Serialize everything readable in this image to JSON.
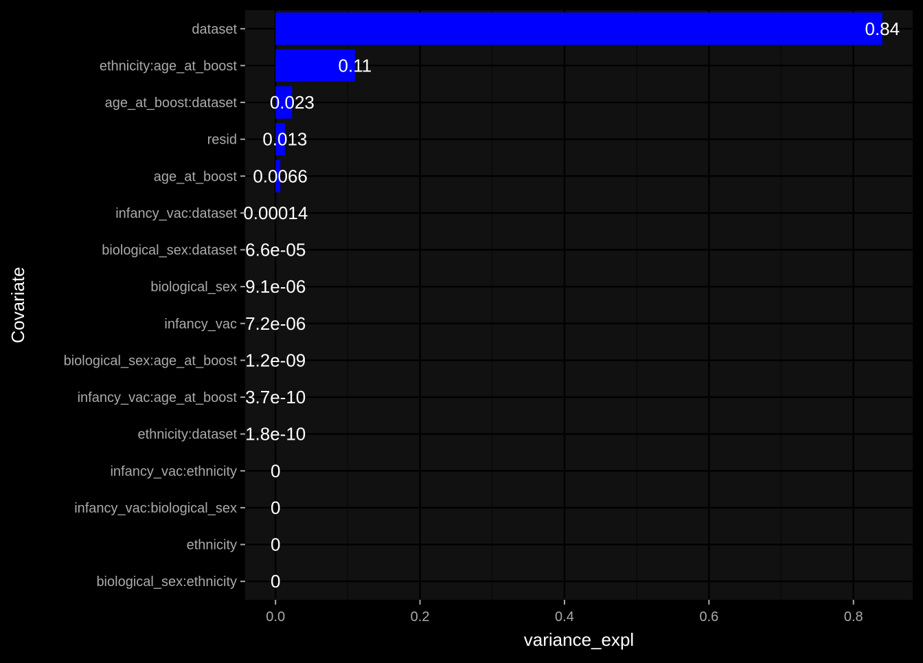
{
  "chart_data": {
    "type": "bar",
    "orientation": "horizontal",
    "title": "",
    "xlabel": "variance_expl",
    "ylabel": "Covariate",
    "categories": [
      "dataset",
      "ethnicity:age_at_boost",
      "age_at_boost:dataset",
      "resid",
      "age_at_boost",
      "infancy_vac:dataset",
      "biological_sex:dataset",
      "biological_sex",
      "infancy_vac",
      "biological_sex:age_at_boost",
      "infancy_vac:age_at_boost",
      "ethnicity:dataset",
      "infancy_vac:ethnicity",
      "infancy_vac:biological_sex",
      "ethnicity",
      "biological_sex:ethnicity"
    ],
    "values": [
      0.84,
      0.11,
      0.023,
      0.013,
      0.0066,
      0.00014,
      6.6e-05,
      9.1e-06,
      7.2e-06,
      1.2e-09,
      3.7e-10,
      1.8e-10,
      0,
      0,
      0,
      0
    ],
    "data_labels": [
      "0.84",
      "0.11",
      "0.023",
      "0.013",
      "0.0066",
      "0.00014",
      "6.6e-05",
      "9.1e-06",
      "7.2e-06",
      "1.2e-09",
      "3.7e-10",
      "1.8e-10",
      "0",
      "0",
      "0",
      "0"
    ],
    "xlim": [
      -0.042,
      0.882
    ],
    "xticks": [
      0.0,
      0.2,
      0.4,
      0.6,
      0.8
    ],
    "xtick_labels": [
      "0.0",
      "0.2",
      "0.4",
      "0.6",
      "0.8"
    ],
    "grid": true,
    "legend": "none",
    "colors": {
      "background": "#000000",
      "panel": "#111111",
      "grid_major": "#000000",
      "grid_minor": "#070707",
      "bar": "#0000FF",
      "label_text": "#FFFFFF",
      "tick_text": "#AAAAAA",
      "axis_title": "#FFFFFF"
    }
  }
}
